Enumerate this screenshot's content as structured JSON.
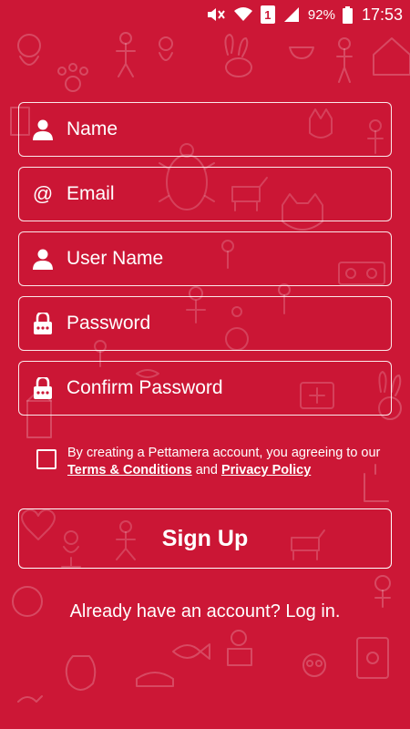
{
  "status_bar": {
    "sim_slot": "1",
    "battery_percent": "92%",
    "time": "17:53"
  },
  "form": {
    "name_placeholder": "Name",
    "email_placeholder": "Email",
    "username_placeholder": "User Name",
    "password_placeholder": "Password",
    "confirm_password_placeholder": "Confirm Password"
  },
  "agreement": {
    "prefix": "By creating a Pettamera account, you agreeing to our ",
    "terms_link": "Terms & Conditions",
    "middle": " and ",
    "privacy_link": "Privacy Policy"
  },
  "signup_label": "Sign Up",
  "login_prompt": "Already have an account? Log in.",
  "colors": {
    "background": "#cc1736",
    "foreground": "#ffffff"
  }
}
